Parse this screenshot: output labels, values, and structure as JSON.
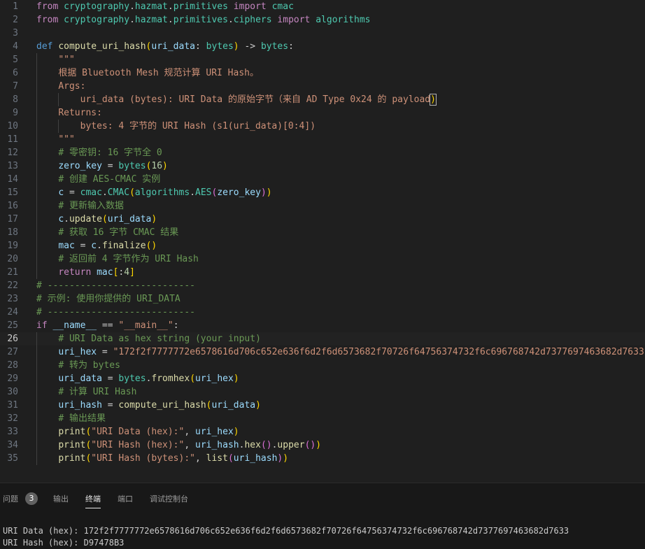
{
  "editor": {
    "current_line": 26,
    "lines": [
      [
        [
          "kw",
          "from"
        ],
        [
          "pl",
          " "
        ],
        [
          "tp",
          "cryptography"
        ],
        [
          "pl",
          "."
        ],
        [
          "tp",
          "hazmat"
        ],
        [
          "pl",
          "."
        ],
        [
          "tp",
          "primitives"
        ],
        [
          "pl",
          " "
        ],
        [
          "kw",
          "import"
        ],
        [
          "pl",
          " "
        ],
        [
          "tp",
          "cmac"
        ]
      ],
      [
        [
          "kw",
          "from"
        ],
        [
          "pl",
          " "
        ],
        [
          "tp",
          "cryptography"
        ],
        [
          "pl",
          "."
        ],
        [
          "tp",
          "hazmat"
        ],
        [
          "pl",
          "."
        ],
        [
          "tp",
          "primitives"
        ],
        [
          "pl",
          "."
        ],
        [
          "tp",
          "ciphers"
        ],
        [
          "pl",
          " "
        ],
        [
          "kw",
          "import"
        ],
        [
          "pl",
          " "
        ],
        [
          "tp",
          "algorithms"
        ]
      ],
      [],
      [
        [
          "kwb",
          "def"
        ],
        [
          "pl",
          " "
        ],
        [
          "fn",
          "compute_uri_hash"
        ],
        [
          "br1",
          "("
        ],
        [
          "var",
          "uri_data"
        ],
        [
          "pl",
          ": "
        ],
        [
          "tp",
          "bytes"
        ],
        [
          "br1",
          ")"
        ],
        [
          "pl",
          " -> "
        ],
        [
          "tp",
          "bytes"
        ],
        [
          "pl",
          ":"
        ]
      ],
      [
        [
          "pl",
          "    "
        ],
        [
          "str",
          "\"\"\""
        ]
      ],
      [
        [
          "pl",
          "    "
        ],
        [
          "str",
          "根据 Bluetooth Mesh 规范计算 URI Hash。"
        ]
      ],
      [
        [
          "pl",
          "    "
        ],
        [
          "str",
          "Args:"
        ]
      ],
      [
        [
          "pl",
          "        "
        ],
        [
          "str",
          "uri_data (bytes): URI Data 的原始字节（来自 AD Type 0x24 的 payload"
        ],
        [
          "bm",
          ")"
        ]
      ],
      [
        [
          "pl",
          "    "
        ],
        [
          "str",
          "Returns:"
        ]
      ],
      [
        [
          "pl",
          "        "
        ],
        [
          "str",
          "bytes: 4 字节的 URI Hash (s1(uri_data)[0:4])"
        ]
      ],
      [
        [
          "pl",
          "    "
        ],
        [
          "str",
          "\"\"\""
        ]
      ],
      [
        [
          "pl",
          "    "
        ],
        [
          "cmt",
          "# 零密钥: 16 字节全 0"
        ]
      ],
      [
        [
          "pl",
          "    "
        ],
        [
          "var",
          "zero_key"
        ],
        [
          "pl",
          " = "
        ],
        [
          "tp",
          "bytes"
        ],
        [
          "br1",
          "("
        ],
        [
          "num",
          "16"
        ],
        [
          "br1",
          ")"
        ]
      ],
      [
        [
          "pl",
          "    "
        ],
        [
          "cmt",
          "# 创建 AES-CMAC 实例"
        ]
      ],
      [
        [
          "pl",
          "    "
        ],
        [
          "var",
          "c"
        ],
        [
          "pl",
          " = "
        ],
        [
          "tp",
          "cmac"
        ],
        [
          "pl",
          "."
        ],
        [
          "tp",
          "CMAC"
        ],
        [
          "br1",
          "("
        ],
        [
          "tp",
          "algorithms"
        ],
        [
          "pl",
          "."
        ],
        [
          "tp",
          "AES"
        ],
        [
          "br2",
          "("
        ],
        [
          "var",
          "zero_key"
        ],
        [
          "br2",
          ")"
        ],
        [
          "br1",
          ")"
        ]
      ],
      [
        [
          "pl",
          "    "
        ],
        [
          "cmt",
          "# 更新输入数据"
        ]
      ],
      [
        [
          "pl",
          "    "
        ],
        [
          "var",
          "c"
        ],
        [
          "pl",
          "."
        ],
        [
          "fn",
          "update"
        ],
        [
          "br1",
          "("
        ],
        [
          "var",
          "uri_data"
        ],
        [
          "br1",
          ")"
        ]
      ],
      [
        [
          "pl",
          "    "
        ],
        [
          "cmt",
          "# 获取 16 字节 CMAC 结果"
        ]
      ],
      [
        [
          "pl",
          "    "
        ],
        [
          "var",
          "mac"
        ],
        [
          "pl",
          " = "
        ],
        [
          "var",
          "c"
        ],
        [
          "pl",
          "."
        ],
        [
          "fn",
          "finalize"
        ],
        [
          "br1",
          "()"
        ]
      ],
      [
        [
          "pl",
          "    "
        ],
        [
          "cmt",
          "# 返回前 4 字节作为 URI Hash"
        ]
      ],
      [
        [
          "pl",
          "    "
        ],
        [
          "kw",
          "return"
        ],
        [
          "pl",
          " "
        ],
        [
          "var",
          "mac"
        ],
        [
          "br1",
          "["
        ],
        [
          "pl",
          ":"
        ],
        [
          "num",
          "4"
        ],
        [
          "br1",
          "]"
        ]
      ],
      [
        [
          "cmt",
          "# ---------------------------"
        ]
      ],
      [
        [
          "cmt",
          "# 示例: 使用你提供的 URI_DATA"
        ]
      ],
      [
        [
          "cmt",
          "# ---------------------------"
        ]
      ],
      [
        [
          "kw",
          "if"
        ],
        [
          "pl",
          " "
        ],
        [
          "var",
          "__name__"
        ],
        [
          "pl",
          " == "
        ],
        [
          "str",
          "\"__main__\""
        ],
        [
          "pl",
          ":"
        ]
      ],
      [
        [
          "pl",
          "    "
        ],
        [
          "cmt",
          "# URI Data as hex string (your input)"
        ]
      ],
      [
        [
          "pl",
          "    "
        ],
        [
          "var",
          "uri_hex"
        ],
        [
          "pl",
          " = "
        ],
        [
          "str",
          "\"172f2f7777772e6578616d706c652e636f6d2f6d6573682f70726f64756374732f6c696768742d7377697463682d7633\""
        ]
      ],
      [
        [
          "pl",
          "    "
        ],
        [
          "cmt",
          "# 转为 bytes"
        ]
      ],
      [
        [
          "pl",
          "    "
        ],
        [
          "var",
          "uri_data"
        ],
        [
          "pl",
          " = "
        ],
        [
          "tp",
          "bytes"
        ],
        [
          "pl",
          "."
        ],
        [
          "fn",
          "fromhex"
        ],
        [
          "br1",
          "("
        ],
        [
          "var",
          "uri_hex"
        ],
        [
          "br1",
          ")"
        ]
      ],
      [
        [
          "pl",
          "    "
        ],
        [
          "cmt",
          "# 计算 URI Hash"
        ]
      ],
      [
        [
          "pl",
          "    "
        ],
        [
          "var",
          "uri_hash"
        ],
        [
          "pl",
          " = "
        ],
        [
          "fn",
          "compute_uri_hash"
        ],
        [
          "br1",
          "("
        ],
        [
          "var",
          "uri_data"
        ],
        [
          "br1",
          ")"
        ]
      ],
      [
        [
          "pl",
          "    "
        ],
        [
          "cmt",
          "# 输出结果"
        ]
      ],
      [
        [
          "pl",
          "    "
        ],
        [
          "fn",
          "print"
        ],
        [
          "br1",
          "("
        ],
        [
          "str",
          "\"URI Data (hex):\""
        ],
        [
          "pl",
          ", "
        ],
        [
          "var",
          "uri_hex"
        ],
        [
          "br1",
          ")"
        ]
      ],
      [
        [
          "pl",
          "    "
        ],
        [
          "fn",
          "print"
        ],
        [
          "br1",
          "("
        ],
        [
          "str",
          "\"URI Hash (hex):\""
        ],
        [
          "pl",
          ", "
        ],
        [
          "var",
          "uri_hash"
        ],
        [
          "pl",
          "."
        ],
        [
          "fn",
          "hex"
        ],
        [
          "br2",
          "()"
        ],
        [
          "pl",
          "."
        ],
        [
          "fn",
          "upper"
        ],
        [
          "br2",
          "()"
        ],
        [
          "br1",
          ")"
        ]
      ],
      [
        [
          "pl",
          "    "
        ],
        [
          "fn",
          "print"
        ],
        [
          "br1",
          "("
        ],
        [
          "str",
          "\"URI Hash (bytes):\""
        ],
        [
          "pl",
          ", "
        ],
        [
          "fn",
          "list"
        ],
        [
          "br2",
          "("
        ],
        [
          "var",
          "uri_hash"
        ],
        [
          "br2",
          ")"
        ],
        [
          "br1",
          ")"
        ]
      ]
    ]
  },
  "panel": {
    "tabs": [
      {
        "label": "问题",
        "badge": "3"
      },
      {
        "label": "输出"
      },
      {
        "label": "终端",
        "active": true
      },
      {
        "label": "端口"
      },
      {
        "label": "调试控制台"
      }
    ],
    "terminal_lines": [
      "URI Data (hex): 172f2f7777772e6578616d706c652e636f6d2f6d6573682f70726f64756374732f6c696768742d7377697463682d7633",
      "URI Hash (hex): D97478B3"
    ]
  }
}
